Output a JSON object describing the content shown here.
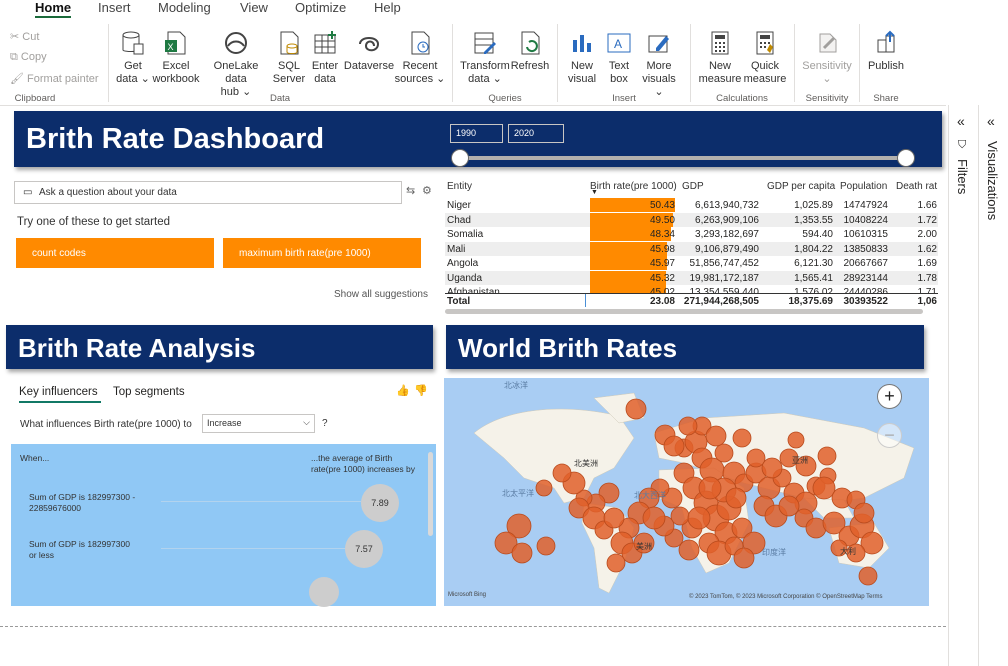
{
  "menu": {
    "tabs": [
      "Home",
      "Insert",
      "Modeling",
      "View",
      "Optimize",
      "Help"
    ]
  },
  "ribbon": {
    "clipboard": {
      "cut": "Cut",
      "copy": "Copy",
      "format_painter": "Format painter",
      "label": "Clipboard"
    },
    "data": {
      "label": "Data",
      "buttons": [
        {
          "l1": "Get",
          "l2": "data ⌄"
        },
        {
          "l1": "Excel",
          "l2": "workbook"
        },
        {
          "l1": "OneLake data",
          "l2": "hub ⌄"
        },
        {
          "l1": "SQL",
          "l2": "Server"
        },
        {
          "l1": "Enter",
          "l2": "data"
        },
        {
          "l1": "Dataverse",
          "l2": ""
        },
        {
          "l1": "Recent",
          "l2": "sources ⌄"
        }
      ]
    },
    "queries": {
      "label": "Queries",
      "transform_l1": "Transform",
      "transform_l2": "data ⌄",
      "refresh": "Refresh"
    },
    "insert": {
      "label": "Insert",
      "new_visual_l1": "New",
      "new_visual_l2": "visual",
      "text_box_l1": "Text",
      "text_box_l2": "box",
      "more_l1": "More",
      "more_l2": "visuals ⌄"
    },
    "calculations": {
      "label": "Calculations",
      "new_measure_l1": "New",
      "new_measure_l2": "measure",
      "quick_l1": "Quick",
      "quick_l2": "measure"
    },
    "sensitivity": {
      "label": "Sensitivity",
      "btn": "Sensitivity",
      "chev": "⌄"
    },
    "share": {
      "label": "Share",
      "publish": "Publish"
    }
  },
  "panes": {
    "filters": "Filters",
    "visualizations": "Visualizations"
  },
  "dashboard": {
    "title": "Brith Rate Dashboard",
    "date_from": "1990",
    "date_to": "2020"
  },
  "qna": {
    "placeholder": "Ask a question about your data",
    "hint": "Try one of these to get started",
    "suggestions": [
      "count codes",
      "maximum birth rate(pre 1000)"
    ],
    "show_all": "Show all suggestions"
  },
  "table": {
    "headers": [
      "Entity",
      "Birth rate(pre 1000)",
      "GDP",
      "GDP per capita",
      "Population",
      "Death rat"
    ],
    "rows": [
      {
        "entity": "Niger",
        "birth": "50.43",
        "gdp": "6,613,940,732",
        "gdppc": "1,025.89",
        "pop": "14747924",
        "death": "1.66"
      },
      {
        "entity": "Chad",
        "birth": "49.50",
        "gdp": "6,263,909,106",
        "gdppc": "1,353.55",
        "pop": "10408224",
        "death": "1.72"
      },
      {
        "entity": "Somalia",
        "birth": "48.34",
        "gdp": "3,293,182,697",
        "gdppc": "594.40",
        "pop": "10610315",
        "death": "2.00"
      },
      {
        "entity": "Mali",
        "birth": "45.98",
        "gdp": "9,106,879,490",
        "gdppc": "1,804.22",
        "pop": "13850833",
        "death": "1.62"
      },
      {
        "entity": "Angola",
        "birth": "45.97",
        "gdp": "51,856,747,452",
        "gdppc": "6,121.30",
        "pop": "20667667",
        "death": "1.69"
      },
      {
        "entity": "Uganda",
        "birth": "45.32",
        "gdp": "19,981,172,187",
        "gdppc": "1,565.41",
        "pop": "28923144",
        "death": "1.78"
      },
      {
        "entity": "Afghanistan",
        "birth": "45.02",
        "gdp": "13,354,559,440",
        "gdppc": "1,576.02",
        "pop": "24440286",
        "death": "1.71"
      }
    ],
    "total": {
      "label": "Total",
      "birth": "23.08",
      "gdp": "271,944,268,505",
      "gdppc": "18,375.69",
      "pop": "30393522",
      "death": "1,06"
    }
  },
  "analysis": {
    "title": "Brith Rate Analysis",
    "tabs": [
      "Key influencers",
      "Top segments"
    ],
    "question": "What influences Birth rate(pre 1000) to",
    "dropdown": "Increase",
    "help": "?",
    "when": "When...",
    "avg_text_1": "...the average of Birth",
    "avg_text_2": "rate(pre 1000) increases by",
    "influencers": [
      {
        "l1": "Sum of GDP is 182997300 -",
        "l2": "22859676000",
        "value": "7.89"
      },
      {
        "l1": "Sum of GDP is 182997300",
        "l2": "or less",
        "value": "7.57"
      }
    ]
  },
  "map": {
    "title": "World Brith Rates",
    "labels": {
      "arctic": "北冰洋",
      "north_america": "北美洲",
      "asia": "亚洲",
      "north_pacific": "北太平洋",
      "north_atlantic": "北大西洋",
      "south_america": "美洲",
      "indian_ocean": "印度洋",
      "australia": "大利"
    },
    "attribution_left": "Microsoft Bing",
    "attribution_right": "© 2023 TomTom, © 2023 Microsoft Corporation  © OpenStreetMap  Terms",
    "zoom_in": "+",
    "zoom_out": "−",
    "colors": {
      "ocean": "#a9cdf3",
      "land": "#f6f3ea",
      "bubble": "#e0602a"
    }
  },
  "colors": {
    "navy": "#0c2d6b",
    "orange": "#ff8a00",
    "ki_blue": "#90c8f5"
  }
}
